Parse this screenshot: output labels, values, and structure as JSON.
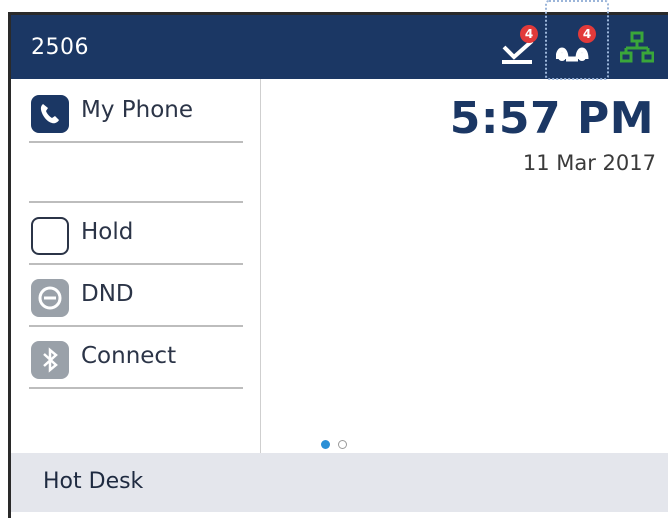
{
  "header": {
    "extension": "2506",
    "icons": [
      {
        "name": "voicemail-icon",
        "badge": "4"
      },
      {
        "name": "missed-calls-icon",
        "badge": "4"
      },
      {
        "name": "network-icon"
      }
    ],
    "colors": {
      "bar": "#1b3764",
      "badge": "#e23a3a",
      "network": "#3aa63a"
    }
  },
  "sidebar": {
    "items": [
      {
        "label": "My Phone",
        "icon": "phone-icon"
      },
      {
        "label": "Hold",
        "icon": "empty-key-icon"
      },
      {
        "label": "DND",
        "icon": "dnd-icon"
      },
      {
        "label": "Connect",
        "icon": "bluetooth-icon"
      }
    ]
  },
  "clock": {
    "time": "5:57 PM",
    "date": "11 Mar 2017"
  },
  "pager": {
    "pages": 2,
    "current": 1
  },
  "softkeys": {
    "hot_desk": "Hot Desk"
  }
}
